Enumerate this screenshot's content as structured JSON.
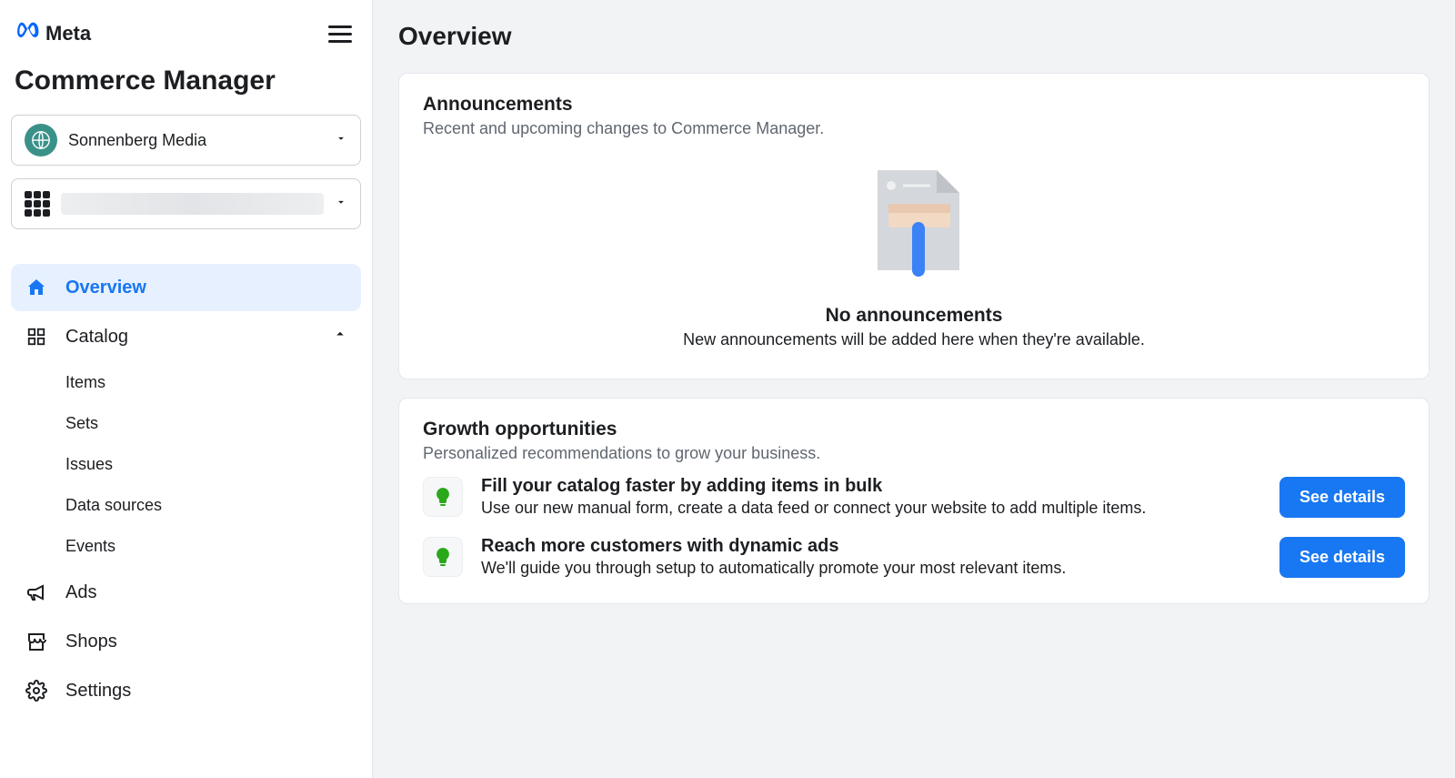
{
  "brand": {
    "name": "Meta",
    "app_title": "Commerce Manager"
  },
  "account_selector": {
    "selected": "Sonnenberg Media"
  },
  "nav": {
    "overview": "Overview",
    "catalog": "Catalog",
    "catalog_children": {
      "items": "Items",
      "sets": "Sets",
      "issues": "Issues",
      "data_sources": "Data sources",
      "events": "Events"
    },
    "ads": "Ads",
    "shops": "Shops",
    "settings": "Settings"
  },
  "page": {
    "title": "Overview"
  },
  "announcements": {
    "heading": "Announcements",
    "subtitle": "Recent and upcoming changes to Commerce Manager.",
    "empty_title": "No announcements",
    "empty_subtitle": "New announcements will be added here when they're available."
  },
  "growth": {
    "heading": "Growth opportunities",
    "subtitle": "Personalized recommendations to grow your business.",
    "items": [
      {
        "title": "Fill your catalog faster by adding items in bulk",
        "subtitle": "Use our new manual form, create a data feed or connect your website to add multiple items.",
        "button": "See details"
      },
      {
        "title": "Reach more customers with dynamic ads",
        "subtitle": "We'll guide you through setup to automatically promote your most relevant items.",
        "button": "See details"
      }
    ]
  }
}
